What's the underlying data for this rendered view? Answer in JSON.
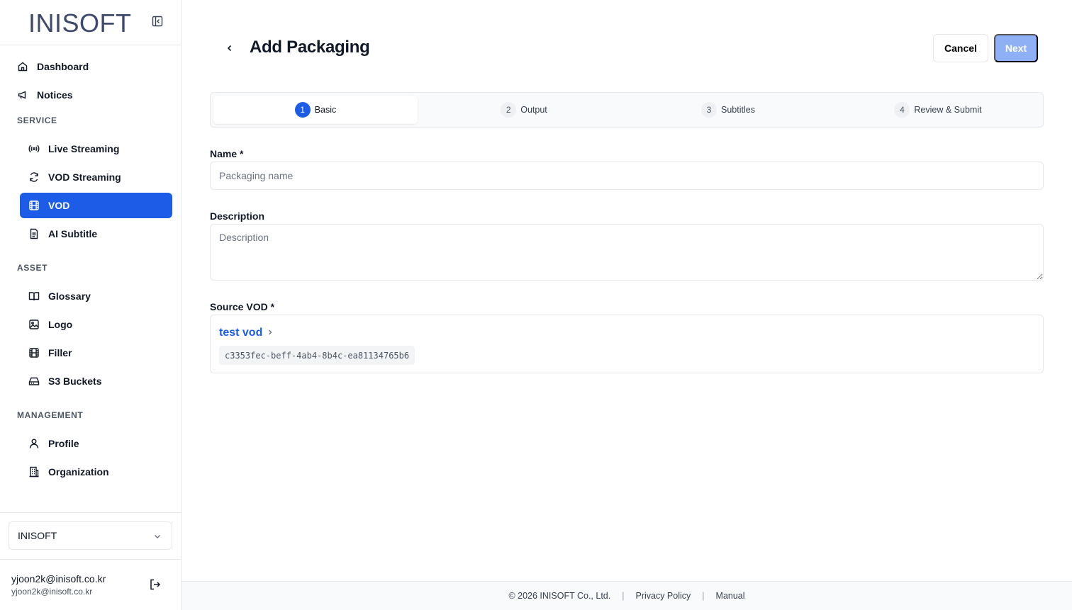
{
  "brand": {
    "logo_text": "INISOFT",
    "accent_color": "#1d5ce6"
  },
  "sidebar": {
    "top_items": [
      {
        "label": "Dashboard",
        "icon": "home-icon"
      },
      {
        "label": "Notices",
        "icon": "megaphone-icon"
      }
    ],
    "sections": [
      {
        "title": "SERVICE",
        "items": [
          {
            "label": "Live Streaming",
            "icon": "broadcast-icon"
          },
          {
            "label": "VOD Streaming",
            "icon": "refresh-icon"
          },
          {
            "label": "VOD",
            "icon": "film-icon",
            "active": true
          },
          {
            "label": "AI Subtitle",
            "icon": "document-icon"
          }
        ]
      },
      {
        "title": "ASSET",
        "items": [
          {
            "label": "Glossary",
            "icon": "book-icon"
          },
          {
            "label": "Logo",
            "icon": "image-icon"
          },
          {
            "label": "Filler",
            "icon": "film-icon"
          },
          {
            "label": "S3 Buckets",
            "icon": "drive-icon"
          }
        ]
      },
      {
        "title": "MANAGEMENT",
        "items": [
          {
            "label": "Profile",
            "icon": "user-icon"
          },
          {
            "label": "Organization",
            "icon": "building-icon"
          }
        ]
      }
    ],
    "org_select": {
      "value": "INISOFT"
    },
    "user": {
      "email": "yjoon2k@inisoft.co.kr",
      "sub": "yjoon2k@inisoft.co.kr"
    }
  },
  "header": {
    "title": "Add Packaging",
    "cancel_label": "Cancel",
    "next_label": "Next"
  },
  "stepper": {
    "steps": [
      {
        "num": "1",
        "label": "Basic",
        "active": true
      },
      {
        "num": "2",
        "label": "Output"
      },
      {
        "num": "3",
        "label": "Subtitles"
      },
      {
        "num": "4",
        "label": "Review & Submit"
      }
    ]
  },
  "form": {
    "name_label": "Name *",
    "name_placeholder": "Packaging name",
    "name_value": "",
    "description_label": "Description",
    "description_placeholder": "Description",
    "source_label": "Source VOD *",
    "source_vod_name": "test vod",
    "source_vod_id": "c3353fec-beff-4ab4-8b4c-ea81134765b6"
  },
  "footer": {
    "copyright": "© 2026 INISOFT Co., Ltd.",
    "privacy": "Privacy Policy",
    "manual": "Manual"
  }
}
